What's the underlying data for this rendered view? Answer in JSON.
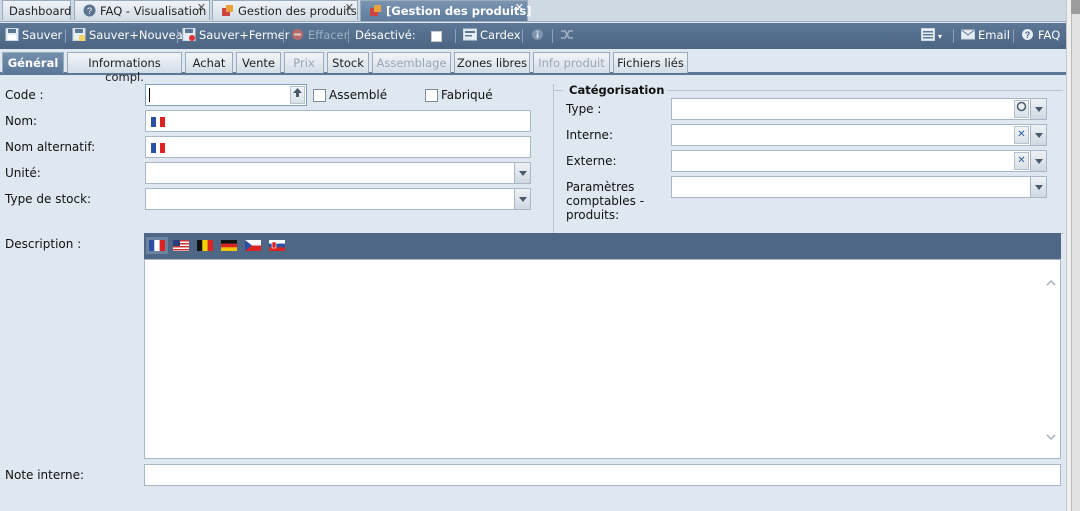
{
  "top_tabs": [
    {
      "label": "Dashboard"
    },
    {
      "label": "FAQ - Visualisation"
    },
    {
      "label": "Gestion des produits"
    },
    {
      "label": "[Gestion des produits]"
    }
  ],
  "toolbar": {
    "save": "Sauver",
    "save_new": "Sauver+Nouveau",
    "save_close": "Sauver+Fermer",
    "delete": "Effacer",
    "disabled_label": "Désactivé:",
    "cardex": "Cardex",
    "email": "Email",
    "faq": "FAQ"
  },
  "sub_tabs": [
    {
      "label": "Général",
      "state": "active"
    },
    {
      "label": "Informations compl.",
      "state": "normal"
    },
    {
      "label": "Achat",
      "state": "normal"
    },
    {
      "label": "Vente",
      "state": "normal"
    },
    {
      "label": "Prix",
      "state": "disabled"
    },
    {
      "label": "Stock",
      "state": "normal"
    },
    {
      "label": "Assemblage",
      "state": "disabled"
    },
    {
      "label": "Zones libres",
      "state": "normal"
    },
    {
      "label": "Info produit",
      "state": "disabled"
    },
    {
      "label": "Fichiers liés",
      "state": "normal"
    }
  ],
  "form": {
    "code_label": "Code :",
    "code_value": "",
    "assembled_label": "Assemblé",
    "manufactured_label": "Fabriqué",
    "name_label": "Nom:",
    "name_value": "",
    "alt_name_label": "Nom alternatif:",
    "alt_name_value": "",
    "unit_label": "Unité:",
    "unit_value": "",
    "stock_type_label": "Type de stock:",
    "stock_type_value": "",
    "description_label": "Description :",
    "internal_note_label": "Note interne:",
    "internal_note_value": ""
  },
  "categorisation": {
    "legend": "Catégorisation",
    "type_label": "Type :",
    "internal_label": "Interne:",
    "external_label": "Externe:",
    "accounting_label_1": "Paramètres",
    "accounting_label_2": "comptables -",
    "accounting_label_3": "produits:"
  },
  "description_languages": [
    "fr-flag-icon",
    "us-flag-icon",
    "be-flag-icon",
    "de-flag-icon",
    "cz-flag-icon",
    "sk-flag-icon"
  ],
  "colors": {
    "toolbar": "#4b6583",
    "active_tab": "#5f7c9c",
    "background": "#dfe8f1"
  }
}
